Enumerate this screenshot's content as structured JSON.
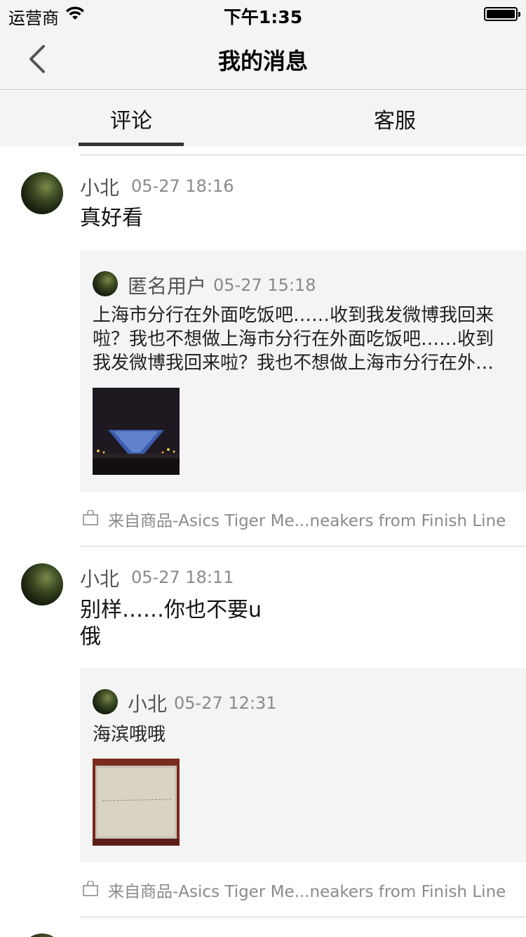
{
  "status_bar": {
    "carrier": "运营商",
    "time": "下午1:35",
    "battery_level": 1.0
  },
  "nav": {
    "title": "我的消息",
    "back_icon": "chevron-left-icon"
  },
  "tabs": [
    {
      "label": "评论",
      "active": true
    },
    {
      "label": "客服",
      "active": false
    }
  ],
  "messages": [
    {
      "author": "小北",
      "time": "05-27 18:16",
      "text": "真好看",
      "quote": {
        "author": "匿名用户",
        "time": "05-27 15:18",
        "text": "上海市分行在外面吃饭吧……收到我发微博我回来啦？我也不想做上海市分行在外面吃饭吧……收到我发微博我回来啦？我也不想做上海市分行在外面吃饭吧……",
        "image": "night-architecture-photo"
      },
      "source": "来自商品-Asics Tiger Me...neakers from Finish Line"
    },
    {
      "author": "小北",
      "time": "05-27 18:11",
      "text_line1": "别样……你也不要u",
      "text_line2": "俄",
      "quote": {
        "author": "小北",
        "time": "05-27 12:31",
        "text": "海滨哦哦",
        "image": "framed-painting-photo"
      },
      "source": "来自商品-Asics Tiger Me...neakers from Finish Line"
    }
  ],
  "colors": {
    "background": "#f4f4f4",
    "text_primary": "#111111",
    "text_secondary": "#8a8a8a",
    "divider": "#d4d4d4"
  }
}
